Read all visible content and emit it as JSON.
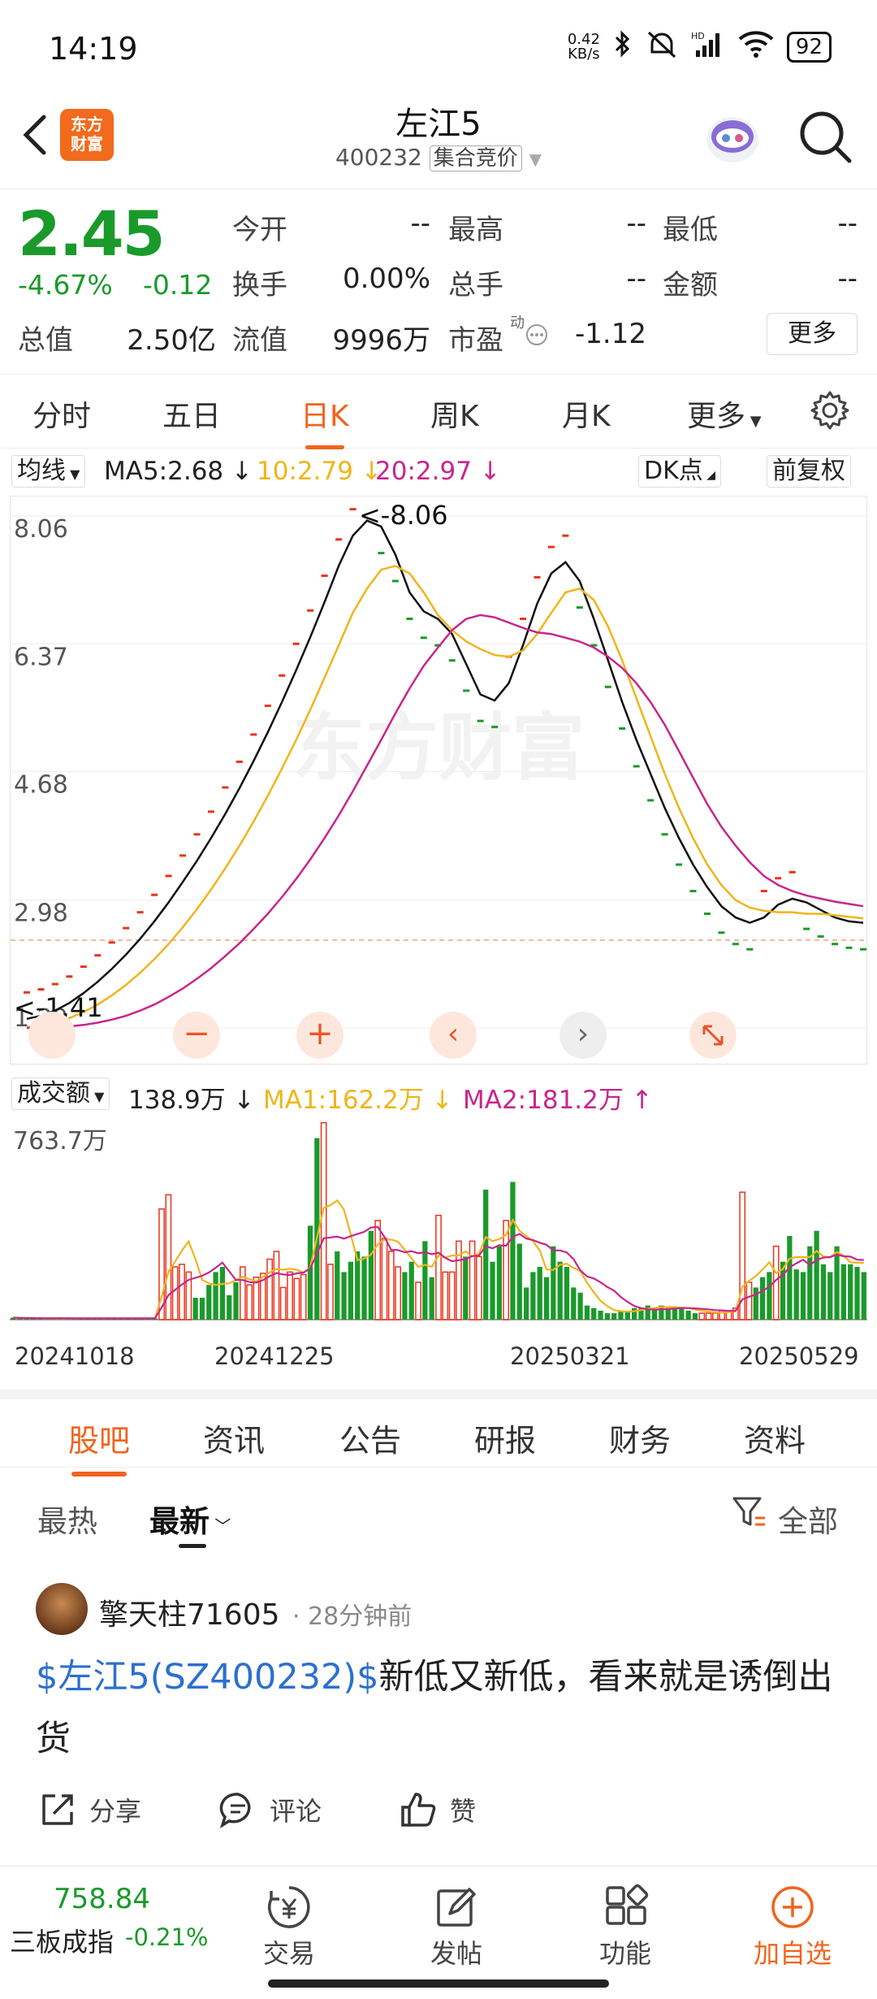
{
  "status_bar": {
    "time": "14:19",
    "net_speed": "0.42 KB/s",
    "net_kb": "0.42",
    "net_unit": "KB/s",
    "signal": "HD",
    "battery": "92"
  },
  "header": {
    "title": "左江5",
    "code": "400232",
    "tag": "集合竞价"
  },
  "quote": {
    "price": "2.45",
    "change_pct": "-4.67%",
    "change": "-0.12",
    "fields": {
      "open_label": "今开",
      "open": "--",
      "high_label": "最高",
      "high": "--",
      "low_label": "最低",
      "low": "--",
      "turnover_label": "换手",
      "turnover": "0.00%",
      "volume_label": "总手",
      "volume": "--",
      "amount_label": "金额",
      "amount": "--",
      "mktcap_label": "总值",
      "mktcap": "2.50亿",
      "float_label": "流值",
      "float": "9996万",
      "pe_label": "市盈",
      "pe_sup": "动",
      "pe": "-1.12"
    },
    "more_label": "更多"
  },
  "kline_tabs": [
    "分时",
    "五日",
    "日K",
    "周K",
    "月K",
    "更多"
  ],
  "kline_active": 2,
  "ma_row": {
    "selector": "均线",
    "ma5": "MA5:2.68 ↓",
    "ma10": "10:2.79 ↓",
    "ma20": "20:2.97 ↓",
    "dk": "DK点",
    "adjust": "前复权"
  },
  "colors": {
    "up": "#e8341c",
    "down": "#1a9a2a",
    "accent": "#f0641e",
    "ma5": "#111111",
    "ma10": "#f0b51c",
    "ma20": "#c8268c"
  },
  "chart_data": [
    {
      "type": "candlestick",
      "title": "",
      "ylim": [
        1.29,
        8.06
      ],
      "y_ticks": [
        "8.06",
        "6.37",
        "4.68",
        "2.98",
        "1.29"
      ],
      "annotations": [
        "<-8.06",
        "<-1.41"
      ],
      "last_price_line": 2.45,
      "series": [
        {
          "name": "MA5",
          "values": [
            1.41,
            1.45,
            1.52,
            1.62,
            1.75,
            1.9,
            2.07,
            2.26,
            2.47,
            2.7,
            2.95,
            3.22,
            3.5,
            3.8,
            4.12,
            4.46,
            4.82,
            5.2,
            5.6,
            6.02,
            6.46,
            6.92,
            7.4,
            7.8,
            8.0,
            7.92,
            7.55,
            7.05,
            6.8,
            6.7,
            6.5,
            6.1,
            5.7,
            5.62,
            5.85,
            6.35,
            6.9,
            7.3,
            7.45,
            7.2,
            6.7,
            6.15,
            5.6,
            5.1,
            4.65,
            4.2,
            3.8,
            3.45,
            3.15,
            2.9,
            2.75,
            2.68,
            2.75,
            2.92,
            3.0,
            2.95,
            2.85,
            2.75,
            2.7,
            2.68
          ]
        },
        {
          "name": "MA10",
          "values": [
            1.3,
            1.32,
            1.36,
            1.42,
            1.5,
            1.6,
            1.72,
            1.86,
            2.02,
            2.2,
            2.4,
            2.62,
            2.86,
            3.12,
            3.4,
            3.7,
            4.02,
            4.36,
            4.72,
            5.1,
            5.5,
            5.92,
            6.35,
            6.78,
            7.1,
            7.35,
            7.4,
            7.3,
            7.05,
            6.75,
            6.55,
            6.4,
            6.3,
            6.22,
            6.2,
            6.28,
            6.5,
            6.78,
            7.05,
            7.1,
            6.95,
            6.6,
            6.15,
            5.65,
            5.15,
            4.65,
            4.2,
            3.8,
            3.45,
            3.18,
            2.98,
            2.88,
            2.84,
            2.82,
            2.82,
            2.8,
            2.8,
            2.78,
            2.76,
            2.74
          ]
        },
        {
          "name": "MA20",
          "values": [
            1.29,
            1.29,
            1.3,
            1.31,
            1.33,
            1.36,
            1.4,
            1.45,
            1.52,
            1.6,
            1.7,
            1.81,
            1.94,
            2.08,
            2.24,
            2.41,
            2.6,
            2.8,
            3.02,
            3.26,
            3.52,
            3.8,
            4.1,
            4.42,
            4.76,
            5.1,
            5.45,
            5.78,
            6.08,
            6.32,
            6.55,
            6.7,
            6.75,
            6.72,
            6.65,
            6.58,
            6.52,
            6.5,
            6.45,
            6.4,
            6.32,
            6.2,
            6.05,
            5.85,
            5.6,
            5.3,
            4.95,
            4.6,
            4.25,
            3.95,
            3.7,
            3.48,
            3.3,
            3.18,
            3.1,
            3.04,
            3.0,
            2.96,
            2.93,
            2.9
          ]
        }
      ]
    },
    {
      "type": "bar",
      "title": "",
      "ylim": [
        0,
        763.7
      ],
      "y_tick": "763.7万",
      "legend": {
        "selector": "成交额",
        "current": "138.9万 ↓",
        "ma1": "MA1:162.2万 ↓",
        "ma2": "MA2:181.2万 ↑"
      },
      "x_labels": [
        "20241018",
        "20241225",
        "20250321",
        "20250529"
      ],
      "values": [
        8,
        6,
        5,
        5,
        5,
        5,
        5,
        6,
        5,
        5,
        5,
        5,
        5,
        5,
        5,
        5,
        5,
        5,
        5,
        5,
        5,
        5,
        430,
        485,
        205,
        215,
        185,
        85,
        85,
        135,
        185,
        205,
        95,
        145,
        205,
        135,
        165,
        180,
        235,
        265,
        125,
        185,
        160,
        175,
        365,
        705,
        765,
        215,
        265,
        185,
        225,
        265,
        245,
        345,
        385,
        315,
        265,
        205,
        185,
        225,
        145,
        305,
        165,
        405,
        185,
        185,
        305,
        245,
        305,
        245,
        505,
        225,
        285,
        385,
        535,
        295,
        125,
        185,
        205,
        165,
        285,
        225,
        205,
        125,
        105,
        55,
        45,
        35,
        25,
        25,
        35,
        35,
        45,
        45,
        55,
        45,
        55,
        45,
        45,
        45,
        35,
        25,
        25,
        25,
        25,
        35,
        35,
        45,
        495,
        145,
        125,
        165,
        185,
        285,
        225,
        325,
        195,
        185,
        285,
        345,
        215,
        185,
        285,
        215,
        215,
        205,
        185
      ],
      "directions": "dddddddddddddddddddddduuuuuddddddduuuuuuuuuudduudddddduuuuddudduuuuduudddudddddddddddddddddddddddddddduuuuuuuudddudddddddddddd"
    }
  ],
  "info_tabs": [
    "股吧",
    "资讯",
    "公告",
    "研报",
    "财务",
    "资料"
  ],
  "info_active": 0,
  "sort": {
    "hot": "最热",
    "latest": "最新",
    "filter": "全部"
  },
  "post": {
    "user": "擎天柱71605",
    "time": "28分钟前",
    "stock_link": "$左江5(SZ400232)$",
    "text": "新低又新低，看来就是诱倒出货",
    "share": "分享",
    "comment": "评论",
    "like": "赞"
  },
  "bottom_bar": {
    "index_value": "758.84",
    "index_name": "三板成指",
    "index_change": "-0.21%",
    "trade": "交易",
    "post": "发帖",
    "functions": "功能",
    "add_watch": "加自选"
  },
  "watermark": "东方财富"
}
